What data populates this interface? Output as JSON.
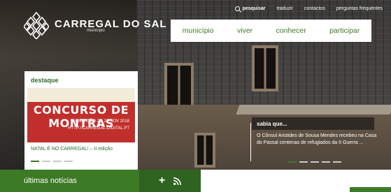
{
  "utility": {
    "search_label": "pesquisar",
    "links": [
      "traduzir",
      "contactos",
      "perguntas frequentes"
    ]
  },
  "logo": {
    "name": "CARREGAL DO SAL",
    "subtitle": "município"
  },
  "nav": {
    "items": [
      "município",
      "viver",
      "conhecer",
      "participar"
    ]
  },
  "destaque": {
    "heading": "destaque",
    "banner_title": "CONCURSO DE MONTRAS",
    "banner_line1": "INSCRIÇÃO 2 A 26 NOV 2018",
    "banner_line2": "HTTP://CARREGAL-DIGITAL.PT",
    "caption": "NATAL É NO CARREGAL! – II edição"
  },
  "sabia": {
    "heading": "sabia que...",
    "text": "O Cônsul Aristides de Sousa Mendes recebeu na Casa do Passal centenas de refugiados da II Guerra ..."
  },
  "news": {
    "label": "últimas notícias"
  },
  "colors": {
    "brand_green": "#3d7a26",
    "dark_green": "#2f6320",
    "banner_red": "#c12f2c"
  },
  "icons": [
    "search-icon",
    "pinecone-logo-icon",
    "plus-icon",
    "rss-icon"
  ]
}
